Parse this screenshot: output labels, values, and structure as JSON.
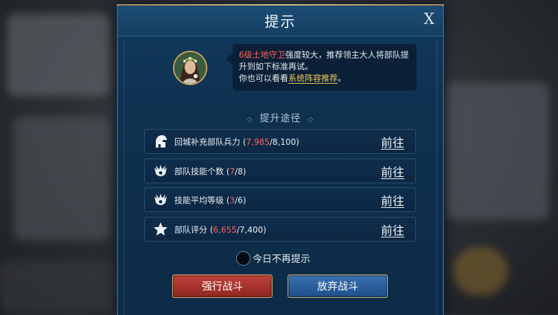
{
  "dialog": {
    "title": "提示",
    "close_label": "X"
  },
  "message": {
    "highlight": "6级土地守卫",
    "line1_rest": "强度较大，推荐领主大人将部队提升到如下标准再试。",
    "line2_prefix": "你也可以看看",
    "link": "系统阵容推荐",
    "line2_suffix": "。"
  },
  "section": {
    "title": "提升途径",
    "ornament": "◇"
  },
  "rows": [
    {
      "icon": "helmet-icon",
      "label": "回城补充部队兵力",
      "current": "7,985",
      "target": "/8,100",
      "go": "前往"
    },
    {
      "icon": "troop-emblem-icon",
      "label": "部队技能个数",
      "current": "7",
      "target": "/8",
      "go": "前往"
    },
    {
      "icon": "skill-emblem-icon",
      "label": "技能平均等级",
      "current": "3",
      "target": "/6",
      "go": "前往"
    },
    {
      "icon": "star-icon",
      "label": "部队评分",
      "current": "6,655",
      "target": "/7,400",
      "go": "前往"
    }
  ],
  "checkbox": {
    "label": "今日不再提示",
    "checked": false
  },
  "buttons": {
    "force_battle": "强行战斗",
    "give_up": "放弃战斗"
  },
  "colors": {
    "highlight_red": "#ff5e5e",
    "link_gold": "#f2c760",
    "accent_gold": "#d7b36a"
  }
}
